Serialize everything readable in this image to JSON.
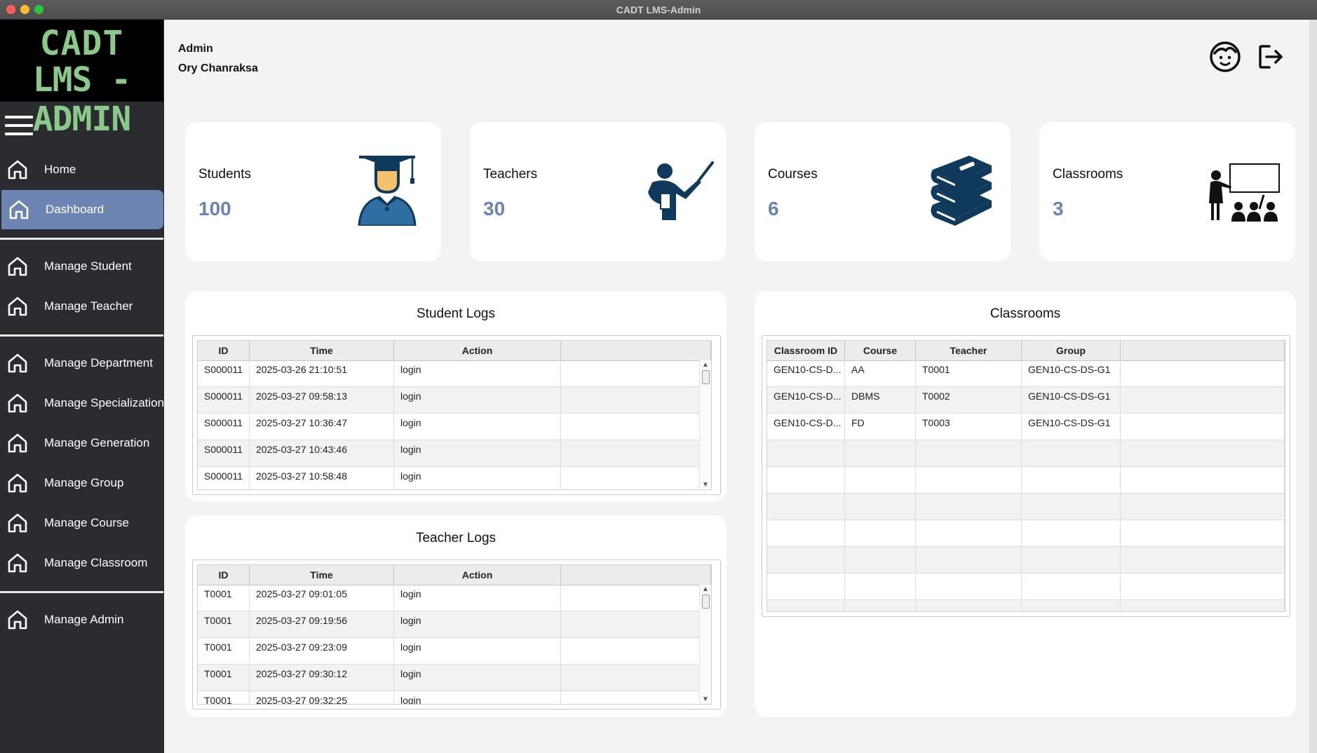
{
  "window": {
    "title": "CADT LMS-Admin"
  },
  "logo": {
    "line1": "CADT",
    "line2": "LMS - ADMIN",
    "color": "#8bc98a"
  },
  "header": {
    "role": "Admin",
    "user_name": "Ory Chanraksa",
    "profile_icon": "user-face-icon",
    "logout_icon": "logout-icon"
  },
  "sidebar": {
    "accent": "#6b84b1",
    "items": [
      {
        "label": "Home",
        "icon": "home-icon"
      },
      {
        "label": "Dashboard",
        "icon": "home-icon",
        "active": true
      },
      {
        "label": "Manage Student",
        "icon": "home-icon"
      },
      {
        "label": "Manage Teacher",
        "icon": "home-icon"
      },
      {
        "label": "Manage Department",
        "icon": "home-icon"
      },
      {
        "label": "Manage Specialization",
        "icon": "home-icon"
      },
      {
        "label": "Manage Generation",
        "icon": "home-icon"
      },
      {
        "label": "Manage Group",
        "icon": "home-icon"
      },
      {
        "label": "Manage Course",
        "icon": "home-icon"
      },
      {
        "label": "Manage Classroom",
        "icon": "home-icon"
      },
      {
        "label": "Manage Admin",
        "icon": "home-icon"
      }
    ]
  },
  "stats": [
    {
      "title": "Students",
      "count": "100",
      "icon": "graduate-icon"
    },
    {
      "title": "Teachers",
      "count": "30",
      "icon": "teacher-icon"
    },
    {
      "title": "Courses",
      "count": "6",
      "icon": "books-icon"
    },
    {
      "title": "Classrooms",
      "count": "3",
      "icon": "classroom-icon"
    }
  ],
  "student_logs": {
    "title": "Student Logs",
    "columns": [
      "ID",
      "Time",
      "Action"
    ],
    "rows": [
      [
        "S000011",
        "2025-03-26 21:10:51",
        "login"
      ],
      [
        "S000011",
        "2025-03-27 09:58:13",
        "login"
      ],
      [
        "S000011",
        "2025-03-27 10:36:47",
        "login"
      ],
      [
        "S000011",
        "2025-03-27 10:43:46",
        "login"
      ],
      [
        "S000011",
        "2025-03-27 10:58:48",
        "login"
      ]
    ]
  },
  "teacher_logs": {
    "title": "Teacher Logs",
    "columns": [
      "ID",
      "Time",
      "Action"
    ],
    "rows": [
      [
        "T0001",
        "2025-03-27 09:01:05",
        "login"
      ],
      [
        "T0001",
        "2025-03-27 09:19:56",
        "login"
      ],
      [
        "T0001",
        "2025-03-27 09:23:09",
        "login"
      ],
      [
        "T0001",
        "2025-03-27 09:30:12",
        "login"
      ],
      [
        "T0001",
        "2025-03-27 09:32:25",
        "login"
      ]
    ]
  },
  "classrooms": {
    "title": "Classrooms",
    "columns": [
      "Classroom ID",
      "Course",
      "Teacher",
      "Group"
    ],
    "rows": [
      [
        "GEN10-CS-D...",
        "AA",
        "T0001",
        "GEN10-CS-DS-G1"
      ],
      [
        "GEN10-CS-D...",
        "DBMS",
        "T0002",
        "GEN10-CS-DS-G1"
      ],
      [
        "GEN10-CS-D...",
        "FD",
        "T0003",
        "GEN10-CS-DS-G1"
      ]
    ]
  }
}
